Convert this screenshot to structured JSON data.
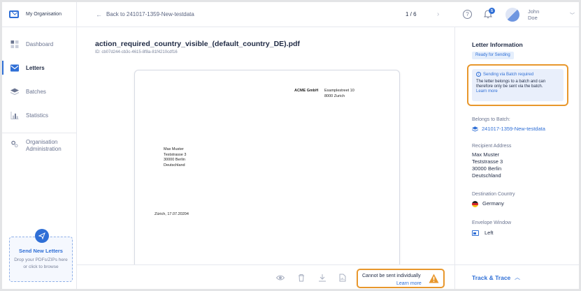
{
  "sidebar": {
    "org_name": "My Organisation",
    "items": [
      {
        "label": "Dashboard",
        "icon": "dashboard-icon"
      },
      {
        "label": "Letters",
        "icon": "envelope-icon"
      },
      {
        "label": "Batches",
        "icon": "layers-icon"
      },
      {
        "label": "Statistics",
        "icon": "bar-chart-icon"
      }
    ],
    "admin_label": "Organisation Administration",
    "upload": {
      "title": "Send New Letters",
      "subtitle": "Drop your PDFs/ZIPs here or click to browse",
      "icon": "send-icon"
    }
  },
  "header": {
    "back_label": "Back to 241017-1359-New-testdata",
    "pager": "1 / 6",
    "help_icon": "help-icon",
    "notification_count": "5",
    "user_first": "John",
    "user_last": "Doe"
  },
  "document": {
    "filename": "action_required_country_visible_(default_country_DE).pdf",
    "id": "ID: cb07d244-cb3c-4615-8f8a-81f4210cdf16",
    "letter": {
      "sender_name": "ACME GmbH",
      "sender_street": "Examplestreet 10",
      "sender_city": "8000 Zurich",
      "recipient": [
        "Max Muster",
        "Teststrasse 3",
        "30000 Berlin",
        "Deutschland"
      ],
      "date": "Zürich, 17.07.20204"
    }
  },
  "toolbar": {
    "warning_text": "Cannot be sent individually",
    "warning_link": "Learn more"
  },
  "panel": {
    "title": "Letter Information",
    "status": "Ready for Sending",
    "batch_notice": {
      "heading": "Sending via Batch required",
      "body": "The letter belongs to a batch and can therefore only be sent via the batch.",
      "link": "Learn more"
    },
    "belongs_label": "Belongs to Batch:",
    "batch_name": "241017-1359-New-testdata",
    "recipient_label": "Recipient Address",
    "recipient": [
      "Max Muster",
      "Teststrasse 3",
      "30000 Berlin",
      "Deutschland"
    ],
    "country_label": "Destination Country",
    "country": "Germany",
    "envelope_label": "Envelope Window",
    "envelope": "Left",
    "track_label": "Track & Trace"
  },
  "colors": {
    "accent": "#2f6fd6",
    "warning": "#e8972c"
  }
}
